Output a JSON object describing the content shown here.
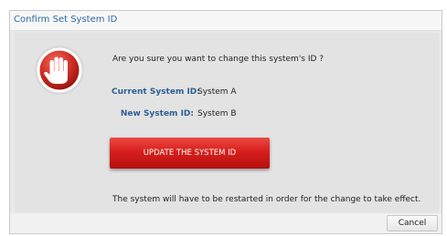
{
  "dialog": {
    "title": "Confirm Set System ID",
    "question": "Are you sure you want to change this system's ID ?",
    "current_label": "Current System ID:",
    "current_value": "System A",
    "new_label": "New System ID:",
    "new_value": "System B",
    "update_button_label": "UPDATE THE SYSTEM ID",
    "restart_note": "The system will have to be restarted in order for the change to take effect.",
    "cancel_button_label": "Cancel",
    "icon": "stop-hand-icon"
  },
  "colors": {
    "title": "#2d6aa3",
    "label": "#2d5f95",
    "update_button": "#d71f1c",
    "icon_red": "#c62a22"
  }
}
